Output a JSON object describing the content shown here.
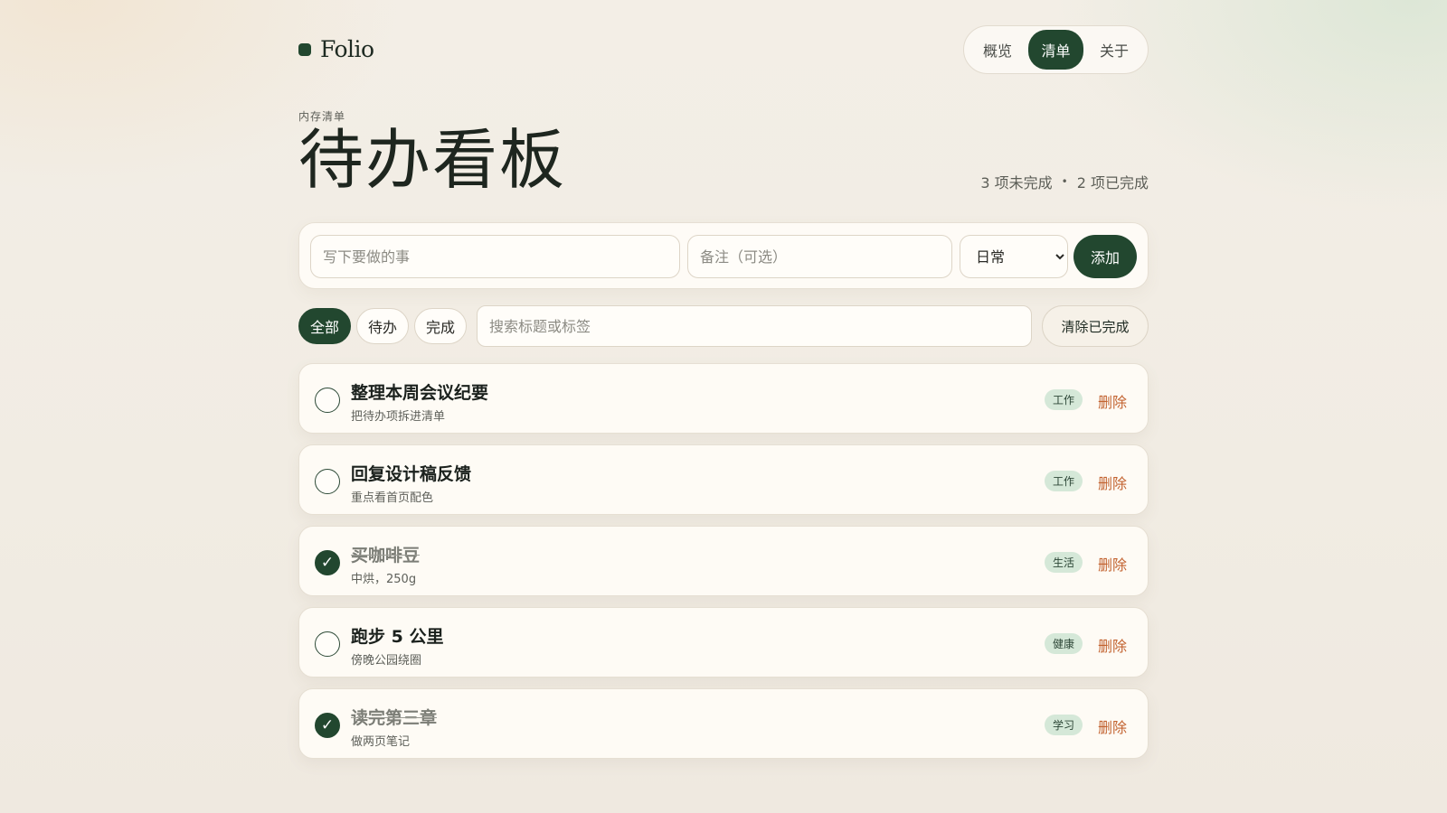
{
  "brand": {
    "name": "Folio"
  },
  "nav": {
    "items": [
      "概览",
      "清单",
      "关于"
    ],
    "active": "清单"
  },
  "header": {
    "eyebrow": "内存清单",
    "title": "待办看板",
    "stats": {
      "open": "3 项未完成",
      "sep": "•",
      "done": "2 项已完成"
    }
  },
  "add_form": {
    "title_placeholder": "写下要做的事",
    "note_placeholder": "备注（可选）",
    "category_selected": "日常",
    "add_label": "添加"
  },
  "filters": {
    "chips": [
      "全部",
      "待办",
      "完成"
    ],
    "active": "全部",
    "search_placeholder": "搜索标题或标签",
    "clear_label": "清除已完成"
  },
  "tasks": [
    {
      "title": "整理本周会议纪要",
      "note": "把待办项拆进清单",
      "tag": "工作",
      "done": false,
      "delete_label": "删除"
    },
    {
      "title": "回复设计稿反馈",
      "note": "重点看首页配色",
      "tag": "工作",
      "done": false,
      "delete_label": "删除"
    },
    {
      "title": "买咖啡豆",
      "note": "中烘，250g",
      "tag": "生活",
      "done": true,
      "delete_label": "删除"
    },
    {
      "title": "跑步 5 公里",
      "note": "傍晚公园绕圈",
      "tag": "健康",
      "done": false,
      "delete_label": "删除"
    },
    {
      "title": "读完第三章",
      "note": "做两页笔记",
      "tag": "学习",
      "done": true,
      "delete_label": "删除"
    }
  ],
  "icons": {
    "check": "checkmark-icon",
    "brand": "brand-square-icon"
  },
  "colors": {
    "primary": "#22472f",
    "danger": "#c2622f",
    "tag_bg": "#d5e8d8",
    "card_bg": "#fefbf5"
  }
}
